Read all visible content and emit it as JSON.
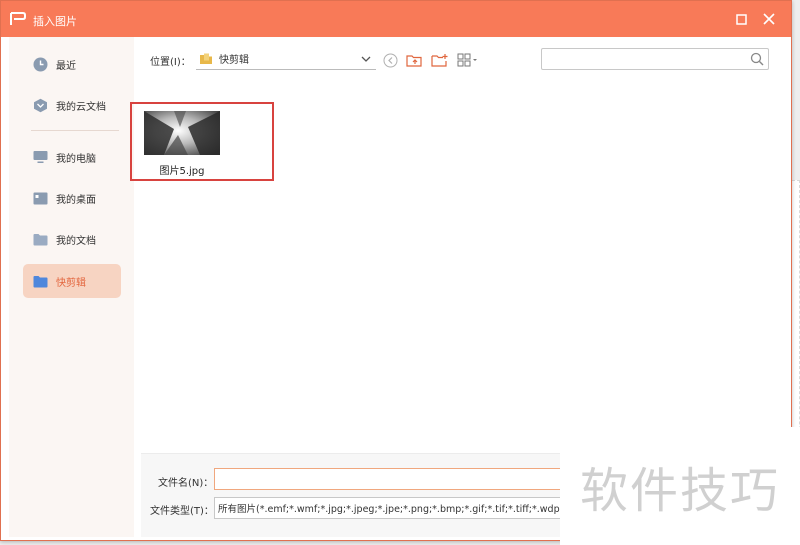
{
  "dialog": {
    "title": "插入图片"
  },
  "sidebar": {
    "items": [
      {
        "label": "最近",
        "icon": "clock-icon"
      },
      {
        "label": "我的云文档",
        "icon": "cloud-doc-icon"
      },
      {
        "label": "我的电脑",
        "icon": "computer-icon"
      },
      {
        "label": "我的桌面",
        "icon": "desktop-icon"
      },
      {
        "label": "我的文档",
        "icon": "folder-icon"
      },
      {
        "label": "快剪辑",
        "icon": "folder-icon",
        "active": true
      }
    ]
  },
  "toolbar": {
    "location_label": "位置(I)：",
    "location_value": "快剪辑",
    "search_placeholder": ""
  },
  "files": [
    {
      "name": "图片5.jpg"
    }
  ],
  "footer": {
    "filename_label": "文件名(N)：",
    "filename_value": "",
    "filetype_label": "文件类型(T)：",
    "filetype_value": "所有图片(*.emf;*.wmf;*.jpg;*.jpeg;*.jpe;*.png;*.bmp;*.gif;*.tif;*.tiff;*.wdp;*.svg)"
  },
  "watermark": "软件技巧",
  "colors": {
    "accent": "#f87a58",
    "active_bg": "#f7d4c2",
    "active_text": "#e3663e",
    "highlight": "#d8433f",
    "folder": "#5b8fd8"
  }
}
